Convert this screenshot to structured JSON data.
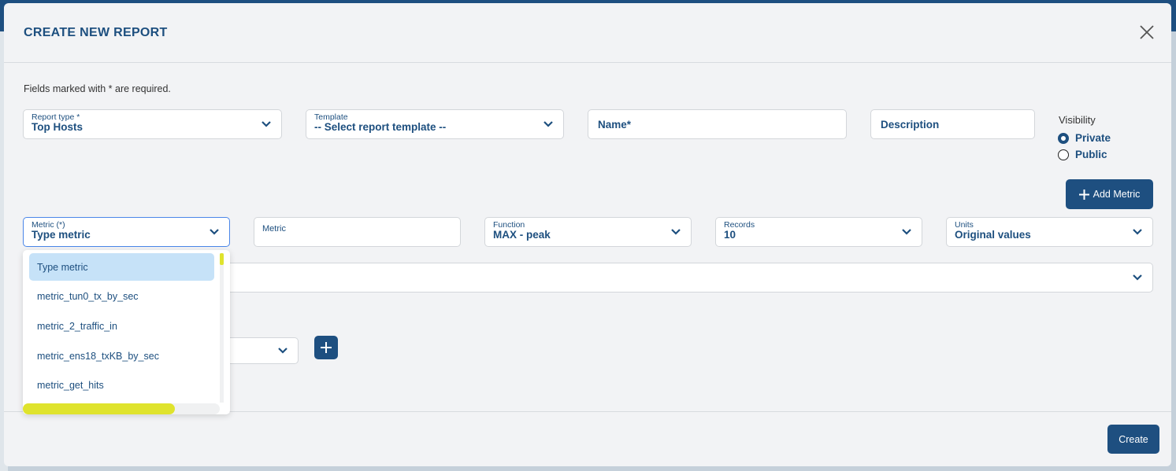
{
  "modal": {
    "title": "CREATE NEW REPORT",
    "required_note": "Fields marked with * are required.",
    "report_type": {
      "label": "Report type *",
      "value": "Top Hosts"
    },
    "template": {
      "label": "Template",
      "value": "-- Select report template --"
    },
    "name": {
      "placeholder": "Name*"
    },
    "description": {
      "placeholder": "Description"
    },
    "visibility": {
      "label": "Visibility",
      "options": [
        {
          "label": "Private",
          "selected": true
        },
        {
          "label": "Public",
          "selected": false
        }
      ]
    },
    "add_metric_label": "Add Metric",
    "metric_select": {
      "label": "Metric (*)",
      "value": "Type metric"
    },
    "metric_input": {
      "label": "Metric"
    },
    "function": {
      "label": "Function",
      "value": "MAX - peak"
    },
    "records": {
      "label": "Records",
      "value": "10"
    },
    "units": {
      "label": "Units",
      "value": "Original values"
    },
    "dropdown": {
      "options": [
        "Type metric",
        "metric_tun0_tx_by_sec",
        "metric_2_traffic_in",
        "metric_ens18_txKB_by_sec",
        "metric_get_hits"
      ],
      "selected_index": 0,
      "horizontal_scroll_fraction": 0.77,
      "scrollbar_color": "#dfe32d"
    },
    "create_label": "Create"
  },
  "colors": {
    "primary": "#1e4f80",
    "highlight": "#c6e2f8"
  }
}
